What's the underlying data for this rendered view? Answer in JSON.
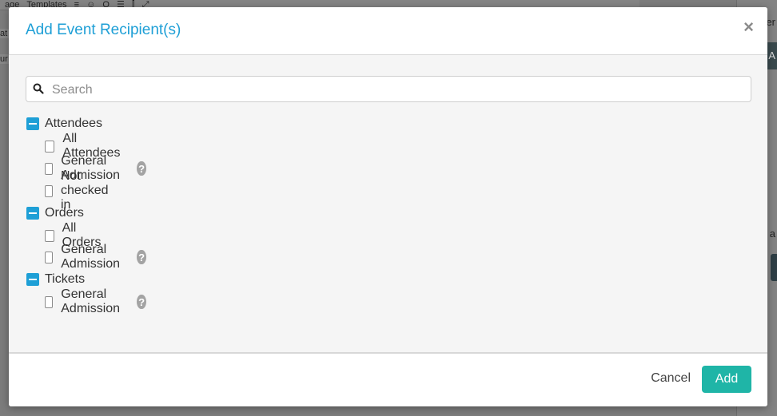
{
  "background": {
    "toolbar_items": [
      "age",
      "Templates",
      "≡",
      "☺",
      "Q",
      "☰",
      "⫿",
      "⤢"
    ],
    "sidebar_fragments": [
      "at",
      "ur"
    ],
    "right_fragments": [
      "er",
      "A",
      "e a"
    ]
  },
  "modal": {
    "title": "Add Event Recipient(s)",
    "close_symbol": "×",
    "search": {
      "placeholder": "Search",
      "value": ""
    },
    "groups": [
      {
        "label": "Attendees",
        "items": [
          {
            "label": "All Attendees",
            "help": false,
            "checked": false
          },
          {
            "label": "General Admission",
            "help": true,
            "checked": false
          },
          {
            "label": "Not checked in",
            "help": false,
            "checked": false
          }
        ]
      },
      {
        "label": "Orders",
        "items": [
          {
            "label": "All Orders",
            "help": false,
            "checked": false
          },
          {
            "label": "General Admission",
            "help": true,
            "checked": false
          }
        ]
      },
      {
        "label": "Tickets",
        "items": [
          {
            "label": "General Admission",
            "help": true,
            "checked": false
          }
        ]
      }
    ],
    "help_symbol": "?",
    "footer": {
      "cancel_label": "Cancel",
      "add_label": "Add"
    }
  },
  "colors": {
    "accent_blue": "#1e9fd6",
    "add_button": "#1fb5a7",
    "help_icon": "#a3a3a3"
  }
}
